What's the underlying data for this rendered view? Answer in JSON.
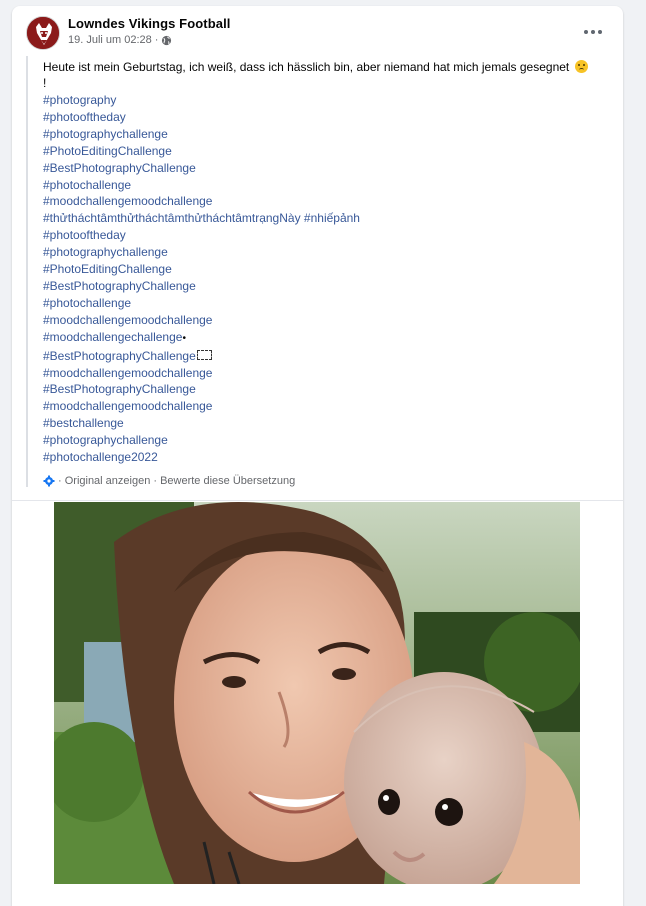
{
  "post": {
    "page_name": "Lowndes Vikings Football",
    "timestamp": "19. Juli um 02:28",
    "separator": "·",
    "audience_icon": "globe-icon",
    "more_icon": "more-horizontal-icon",
    "text": "Heute ist mein Geburtstag, ich weiß, dass ich hässlich bin, aber niemand hat mich jemals gesegnet",
    "text_end": "!",
    "emoji": "sad-face-emoji",
    "hashtags": [
      "#photography",
      "#photooftheday",
      "#photographychallenge",
      "#PhotoEditingChallenge",
      "#BestPhotographyChallenge",
      "#photochallenge",
      "#moodchallengemoodchallenge",
      "#thửtháchtâmthửtháchtâmthửtháchtâmtrạngNày",
      "#photooftheday",
      "#photographychallenge",
      "#PhotoEditingChallenge",
      "#BestPhotographyChallenge",
      "#photochallenge",
      "#moodchallengemoodchallenge",
      "#moodchallengechallenge",
      "#BestPhotographyChallenge",
      "#moodchallengemoodchallenge",
      "#BestPhotographyChallenge",
      "#moodchallengemoodchallenge",
      "#bestchallenge",
      "#photographychallenge",
      "#photochallenge2022"
    ],
    "inline_hashtag": "#nhiếpảnh",
    "translation": {
      "icon": "gear-icon",
      "show_original": "· Original anzeigen",
      "rate": "· Bewerte diese Übersetzung"
    }
  },
  "colors": {
    "link": "#385898",
    "text": "#050505",
    "meta": "#65676b",
    "avatar_red": "#8b1a1a"
  }
}
